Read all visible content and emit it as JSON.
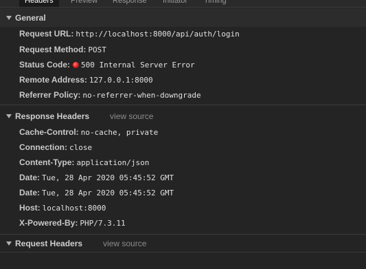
{
  "tabs": [
    "Headers",
    "Preview",
    "Response",
    "Initiator",
    "Timing"
  ],
  "general": {
    "title": "General",
    "rows": [
      {
        "key": "Request URL:",
        "value": "http://localhost:8000/api/auth/login"
      },
      {
        "key": "Request Method:",
        "value": "POST"
      },
      {
        "key": "Status Code:",
        "value": "500 Internal Server Error",
        "status_color": "#e21010"
      },
      {
        "key": "Remote Address:",
        "value": "127.0.0.1:8000"
      },
      {
        "key": "Referrer Policy:",
        "value": "no-referrer-when-downgrade"
      }
    ]
  },
  "response_headers": {
    "title": "Response Headers",
    "view_source": "view source",
    "rows": [
      {
        "key": "Cache-Control:",
        "value": "no-cache, private"
      },
      {
        "key": "Connection:",
        "value": "close"
      },
      {
        "key": "Content-Type:",
        "value": "application/json"
      },
      {
        "key": "Date:",
        "value": "Tue, 28 Apr 2020 05:45:52 GMT"
      },
      {
        "key": "Date:",
        "value": "Tue, 28 Apr 2020 05:45:52 GMT"
      },
      {
        "key": "Host:",
        "value": "localhost:8000"
      },
      {
        "key": "X-Powered-By:",
        "value": "PHP/7.3.11"
      }
    ]
  },
  "request_headers": {
    "title": "Request Headers",
    "view_source": "view source"
  }
}
